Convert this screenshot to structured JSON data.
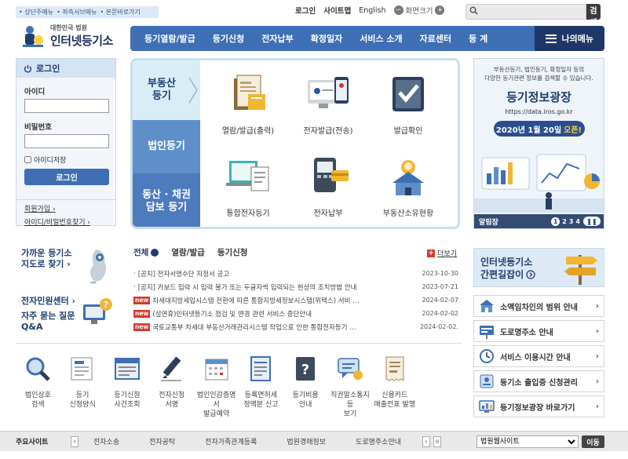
{
  "skip_links": [
    "• 상단주메뉴",
    "• 좌측서브메뉴",
    "• 본문바로가기"
  ],
  "util": {
    "login": "로그인",
    "sitemap": "사이트맵",
    "english": "English",
    "zoom_label": "화면크기",
    "zoom_minus": "−",
    "zoom_plus": "+"
  },
  "search": {
    "button": "검색",
    "placeholder": ""
  },
  "logo": {
    "line1": "대한민국 법원",
    "line2": "인터넷등기소"
  },
  "gnb": [
    "등기열람/발급",
    "등기신청",
    "전자납부",
    "확정일자",
    "서비스 소개",
    "자료센터",
    "등 계"
  ],
  "mymenu": "나의메뉴",
  "login": {
    "title": "로그인",
    "id_label": "아이디",
    "pw_label": "비밀번호",
    "save_label": "아이디저장",
    "button": "로그인",
    "join": "회원가입",
    "find": "아이디/비밀번호찾기"
  },
  "quick": {
    "tab1": "부동산\n등기",
    "tab2": "법인등기",
    "tab3": "동산 · 채권\n담보 등기",
    "items": [
      "열람/발급(출력)",
      "전자발급(전송)",
      "발급확인",
      "통합전자등기",
      "전자납부",
      "부동산소유현황"
    ]
  },
  "banner": {
    "desc": "부동산등기, 법인등기, 확정일자 등의\n다양한 등기관련 정보를 검색할 수 있습니다.",
    "title": "등기정보광장",
    "url": "https://data.iros.go.kr",
    "date": "2020년 1월 20일",
    "open": "오픈!",
    "alarm": "알림창",
    "pages": [
      "1",
      "2",
      "3",
      "4"
    ]
  },
  "left2": {
    "map1": "가까운 등기소",
    "map2": "지도로 찾기 ›",
    "cs1": "전자민원센터 ›",
    "cs2": "자주 묻는 질문",
    "cs3": "Q&A"
  },
  "news": {
    "tabs": [
      "전체",
      "열람/발급",
      "등기신청"
    ],
    "more": "더보기",
    "new_badge": "new",
    "items": [
      {
        "text": "[공지] 전자서명수단 지정서 공고",
        "date": "2023-10-30",
        "new": false
      },
      {
        "text": "[공지] 카보드 입력 시 입력 불가 또는 두글자씩 입력되는 현상의 조치방법 안내",
        "date": "2023-07-21",
        "new": false
      },
      {
        "text": "차세대지방세입시스템 전환에 따른 통합지방세정보시스템(위택스) 서비 …",
        "date": "2024-02-07",
        "new": true
      },
      {
        "text": "(설연휴)인터넷등기소 점검 및 변경 관련 서비스 중단안내",
        "date": "2024-02-02",
        "new": true
      },
      {
        "text": "국토교통부 차세대 부동산거래관리시스템 작업으로 인한 통합전자등기 …",
        "date": "2024-02-02.",
        "new": true
      }
    ]
  },
  "icon_row": [
    "법인상호\n검색",
    "등기\n신청양식",
    "등기신청\n사건조회",
    "전자신청\n서명",
    "법인인감증명서\n발급예약",
    "등록면허세\n정액분 신고",
    "등기비용\n안내",
    "직권말소통지등\n보기",
    "신용카드\n매출전표 발행"
  ],
  "guide": {
    "line1": "인터넷등기소",
    "line2": "간편길잡이"
  },
  "right_links": [
    "소액임차인의 범위 안내",
    "도로명주소 안내",
    "서비스 이용시간 안내",
    "등기소 출입증 신청관리",
    "등기정보광장 바로가기"
  ],
  "footer": {
    "label": "주요사이트",
    "links": [
      "전자소송",
      "전자공탁",
      "전자가족관계등록",
      "법원경매정보",
      "도로명주소안내"
    ],
    "select": "법원웹사이트",
    "go": "이동"
  },
  "colors": {
    "primary": "#3e6fb5",
    "navy": "#1f3d6d",
    "red": "#d9372c"
  }
}
